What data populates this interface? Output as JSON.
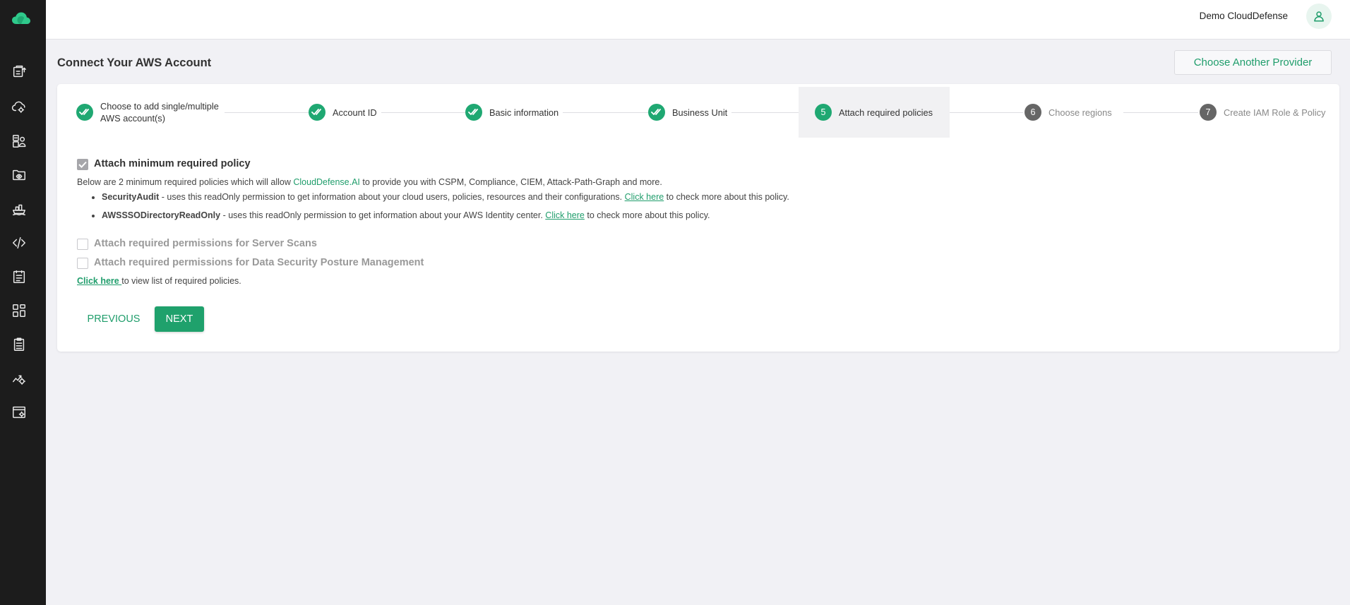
{
  "app": {
    "brand_color": "#1f9d6b"
  },
  "sidebar": {
    "items": [
      {
        "icon": "box-upload-icon"
      },
      {
        "icon": "cloud-gear-icon"
      },
      {
        "icon": "id-user-icon"
      },
      {
        "icon": "folder-eye-icon"
      },
      {
        "icon": "container-ship-icon"
      },
      {
        "icon": "code-icon"
      },
      {
        "icon": "report-list-icon"
      },
      {
        "icon": "dashboard-grid-icon"
      },
      {
        "icon": "clipboard-icon"
      },
      {
        "icon": "chart-gear-icon"
      },
      {
        "icon": "browser-settings-icon"
      }
    ]
  },
  "header": {
    "user_name": "Demo CloudDefense"
  },
  "page": {
    "title": "Connect Your AWS Account",
    "choose_provider_label": "Choose Another Provider"
  },
  "stepper": {
    "steps": [
      {
        "label": "Choose to add single/multiple AWS account(s)",
        "state": "done"
      },
      {
        "label": "Account ID",
        "state": "done"
      },
      {
        "label": "Basic information",
        "state": "done"
      },
      {
        "label": "Business Unit",
        "state": "done"
      },
      {
        "number": "5",
        "label": "Attach required policies",
        "state": "current"
      },
      {
        "number": "6",
        "label": "Choose regions",
        "state": "todo"
      },
      {
        "number": "7",
        "label": "Create IAM Role & Policy",
        "state": "todo"
      }
    ]
  },
  "policies": {
    "min_policy_label": "Attach minimum required policy",
    "min_policy_checked": true,
    "desc_prefix": "Below are 2 minimum required policies which will allow ",
    "desc_brand": "CloudDefense.AI",
    "desc_suffix": " to provide you with CSPM, Compliance, CIEM, Attack-Path-Graph and more.",
    "items": [
      {
        "name": "SecurityAudit",
        "text": " - uses this readOnly permission to get information about your cloud users, policies, resources and their configurations. ",
        "link": "Click here",
        "after": " to check more about this policy."
      },
      {
        "name": "AWSSSODirectoryReadOnly",
        "text": " - uses this readOnly permission to get information about your AWS Identity center. ",
        "link": "Click here",
        "after": " to check more about this policy."
      }
    ],
    "server_scans_label": "Attach required permissions for Server Scans",
    "server_scans_checked": false,
    "dspm_label": "Attach required permissions for Data Security Posture Management",
    "dspm_checked": false,
    "view_list_link": "Click here ",
    "view_list_text": "to view list of required policies."
  },
  "actions": {
    "previous_label": "PREVIOUS",
    "next_label": "NEXT"
  }
}
